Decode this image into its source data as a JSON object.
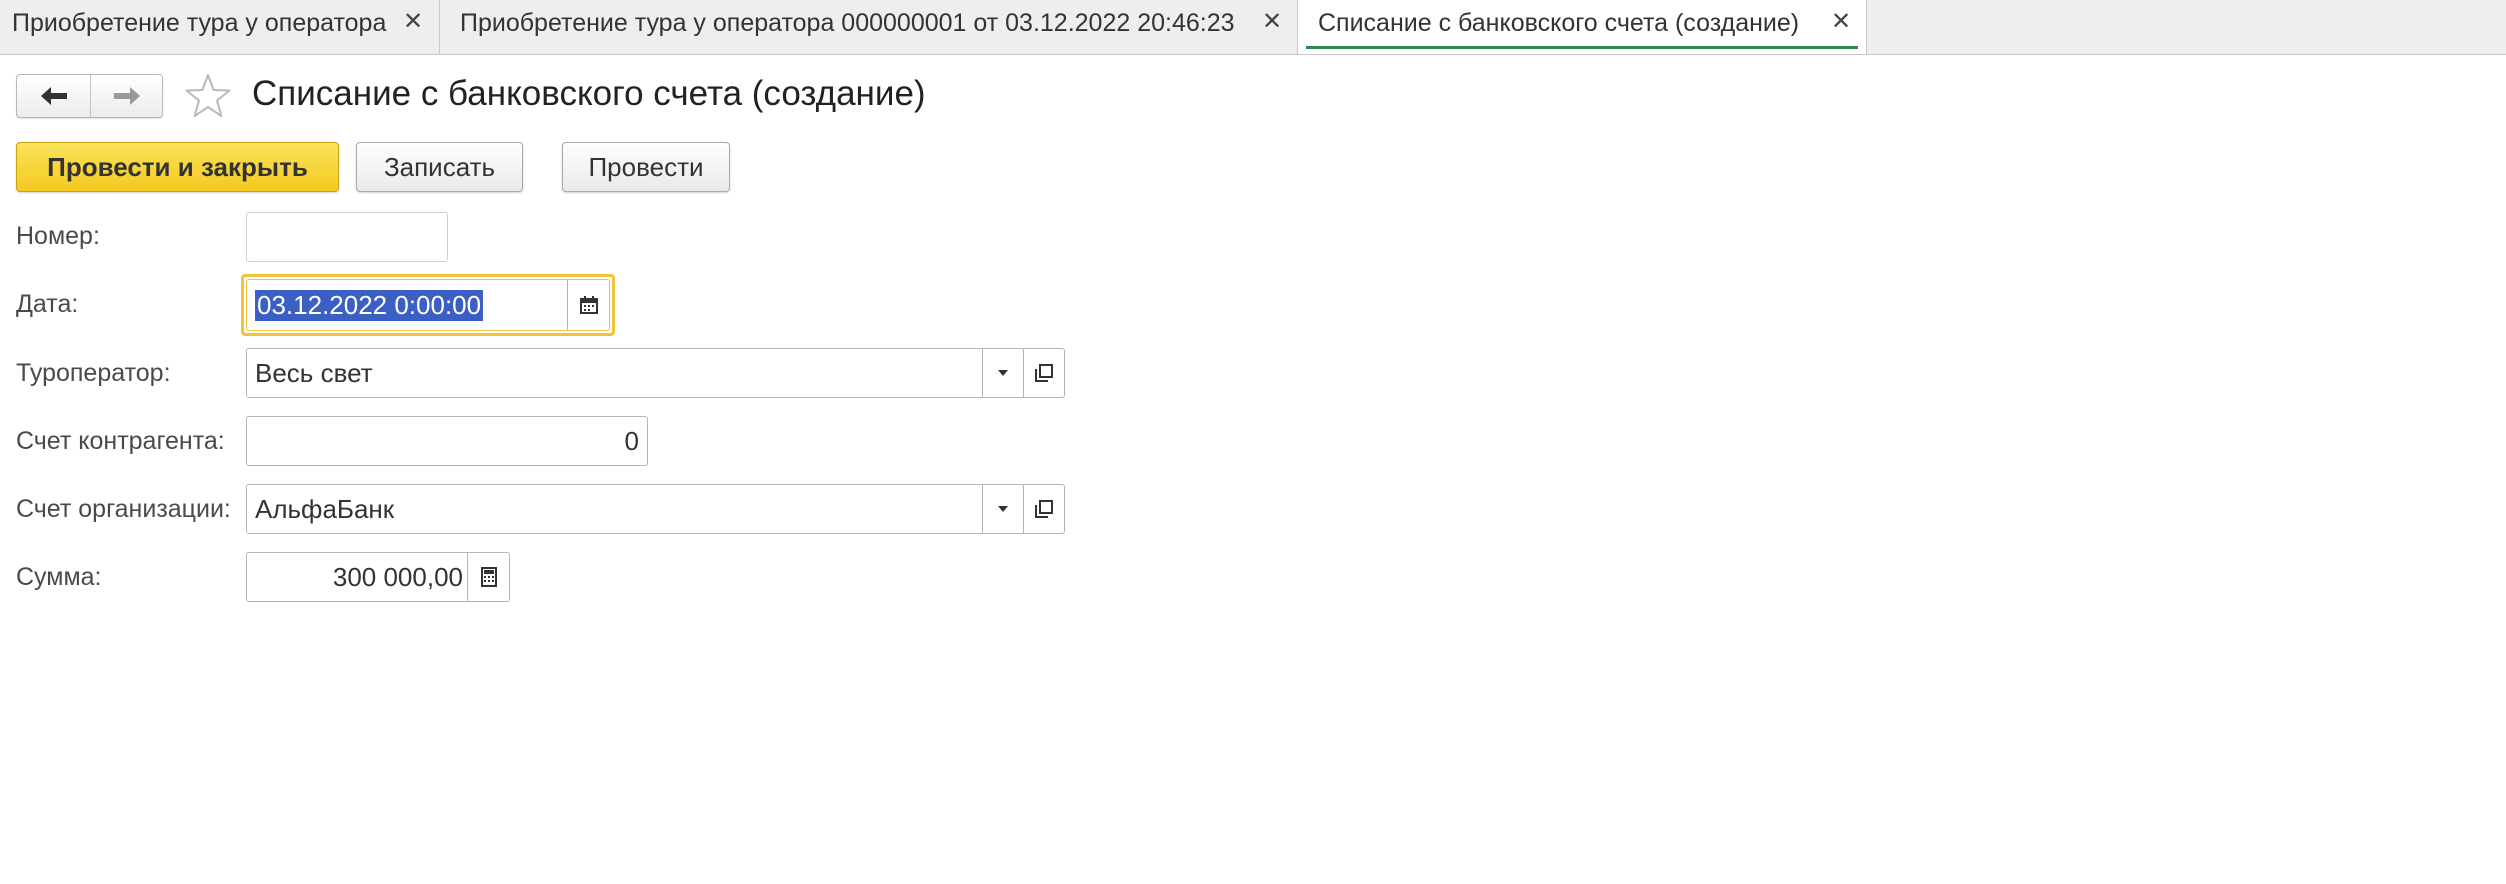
{
  "tabs": [
    {
      "label": "Приобретение тура у оператора",
      "active": false
    },
    {
      "label": "Приобретение тура у оператора 000000001 от 03.12.2022 20:46:23",
      "active": false
    },
    {
      "label": "Списание с банковского счета (создание)",
      "active": true
    }
  ],
  "header": {
    "title": "Списание с банковского счета (создание)"
  },
  "toolbar": {
    "post_and_close": "Провести и закрыть",
    "save": "Записать",
    "post": "Провести"
  },
  "form": {
    "number": {
      "label": "Номер:",
      "value": ""
    },
    "date": {
      "label": "Дата:",
      "value": "03.12.2022  0:00:00"
    },
    "tour_operator": {
      "label": "Туроператор:",
      "value": "Весь свет"
    },
    "counterparty_account": {
      "label": "Счет контрагента:",
      "value": "0"
    },
    "organization_account": {
      "label": "Счет организации:",
      "value": "АльфаБанк"
    },
    "amount": {
      "label": "Сумма:",
      "value": "300 000,00"
    }
  },
  "colors": {
    "primary_button": "#f3c91f",
    "active_tab_underline": "#2c8a4a",
    "focus_border": "#f3c337",
    "selection": "#3b5fc5"
  },
  "icons": [
    "close-icon",
    "back-arrow-icon",
    "forward-arrow-icon",
    "star-icon",
    "calendar-icon",
    "dropdown-arrow-icon",
    "open-link-icon",
    "calculator-icon"
  ]
}
